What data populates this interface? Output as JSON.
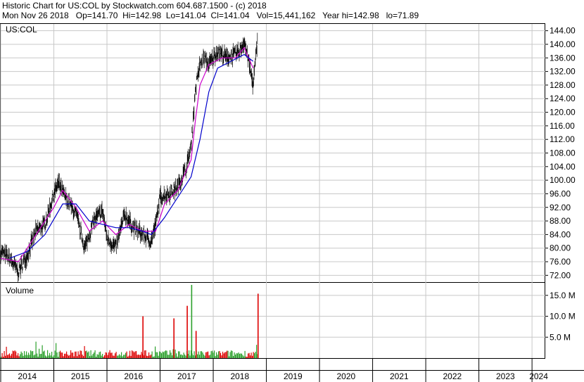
{
  "header": {
    "line1": "Historic Chart for US:COL by Stockwatch.com 604.687.1500 - (c) 2018",
    "line2": "Mon Nov 26 2018   Op=141.70  Hi=142.98  Lo=141.04  Cl=141.04   Vol=15,441,162   Year hi=142.98   lo=71.89"
  },
  "colors": {
    "price": "#000000",
    "ma_short": "#cc00cc",
    "ma_long": "#0000cc",
    "volume_up": "#2ca02c",
    "volume_down": "#dd0000",
    "grid": "#c8c8c8"
  },
  "chart_data": [
    {
      "type": "line",
      "title": "US:COL",
      "ylim": [
        70,
        146
      ],
      "yticks": [
        "144.00",
        "140.00",
        "136.00",
        "132.00",
        "128.00",
        "124.00",
        "120.00",
        "116.00",
        "112.00",
        "108.00",
        "104.00",
        "100.00",
        "96.00",
        "92.00",
        "88.00",
        "84.00",
        "80.00",
        "76.00",
        "72.00"
      ],
      "x_years": [
        "2014",
        "2015",
        "2016",
        "2017",
        "2018",
        "2019",
        "2020",
        "2021",
        "2022",
        "2023",
        "2024"
      ],
      "x_start": "2014-01",
      "x_end": "2024-04",
      "series": [
        {
          "values": [
            [
              "2014-01",
              79
            ],
            [
              "2014-03",
              77
            ],
            [
              "2014-05",
              73
            ],
            [
              "2014-07",
              78
            ],
            [
              "2014-09",
              85
            ],
            [
              "2014-11",
              87
            ],
            [
              "2015-01",
              96
            ],
            [
              "2015-02",
              99
            ],
            [
              "2015-04",
              94
            ],
            [
              "2015-06",
              90
            ],
            [
              "2015-08",
              80
            ],
            [
              "2015-10",
              88
            ],
            [
              "2015-12",
              91
            ],
            [
              "2016-01",
              83
            ],
            [
              "2016-03",
              80
            ],
            [
              "2016-05",
              90
            ],
            [
              "2016-07",
              86
            ],
            [
              "2016-09",
              84
            ],
            [
              "2016-11",
              82
            ],
            [
              "2016-12",
              87
            ],
            [
              "2017-01",
              95
            ],
            [
              "2017-03",
              96
            ],
            [
              "2017-05",
              98
            ],
            [
              "2017-07",
              104
            ],
            [
              "2017-08",
              110
            ],
            [
              "2017-09",
              127
            ],
            [
              "2017-10",
              134
            ],
            [
              "2017-11",
              136
            ],
            [
              "2017-12",
              134
            ],
            [
              "2018-02",
              138
            ],
            [
              "2018-04",
              136
            ],
            [
              "2018-06",
              137
            ],
            [
              "2018-07",
              138
            ],
            [
              "2018-08",
              141
            ],
            [
              "2018-09",
              135
            ],
            [
              "2018-10",
              128
            ],
            [
              "2018-11",
              141
            ]
          ]
        },
        {
          "values": [
            [
              "2014-01",
              77
            ],
            [
              "2014-05",
              76
            ],
            [
              "2014-09",
              84
            ],
            [
              "2015-01",
              92
            ],
            [
              "2015-03",
              97
            ],
            [
              "2015-06",
              92
            ],
            [
              "2015-09",
              85
            ],
            [
              "2015-12",
              88
            ],
            [
              "2016-03",
              84
            ],
            [
              "2016-06",
              87
            ],
            [
              "2016-09",
              85
            ],
            [
              "2016-12",
              85
            ],
            [
              "2017-02",
              93
            ],
            [
              "2017-05",
              97
            ],
            [
              "2017-08",
              106
            ],
            [
              "2017-09",
              118
            ],
            [
              "2017-10",
              128
            ],
            [
              "2017-12",
              134
            ],
            [
              "2018-03",
              136
            ],
            [
              "2018-06",
              136
            ],
            [
              "2018-08",
              139
            ],
            [
              "2018-09",
              136
            ],
            [
              "2018-10",
              133
            ]
          ]
        },
        {
          "values": [
            [
              "2014-03",
              77
            ],
            [
              "2014-07",
              79
            ],
            [
              "2014-11",
              84
            ],
            [
              "2015-03",
              93
            ],
            [
              "2015-06",
              93
            ],
            [
              "2015-09",
              88
            ],
            [
              "2015-12",
              87
            ],
            [
              "2016-03",
              86
            ],
            [
              "2016-06",
              86
            ],
            [
              "2016-09",
              85
            ],
            [
              "2016-11",
              84
            ],
            [
              "2017-02",
              89
            ],
            [
              "2017-05",
              95
            ],
            [
              "2017-08",
              101
            ],
            [
              "2017-10",
              112
            ],
            [
              "2017-12",
              126
            ],
            [
              "2018-02",
              133
            ],
            [
              "2018-05",
              135
            ],
            [
              "2018-08",
              137
            ],
            [
              "2018-10",
              135
            ]
          ]
        }
      ]
    },
    {
      "type": "bar",
      "title": "Volume",
      "ylim": [
        0,
        18
      ],
      "yticks": [
        "15.0 M",
        "10.0 M",
        "5.0 M"
      ],
      "spikes": [
        [
          "2016-09",
          10.0
        ],
        [
          "2017-04",
          9.5
        ],
        [
          "2017-08",
          17.5
        ],
        [
          "2017-07",
          12.5
        ],
        [
          "2017-09",
          6.5
        ],
        [
          "2018-11",
          15.4
        ]
      ]
    }
  ]
}
